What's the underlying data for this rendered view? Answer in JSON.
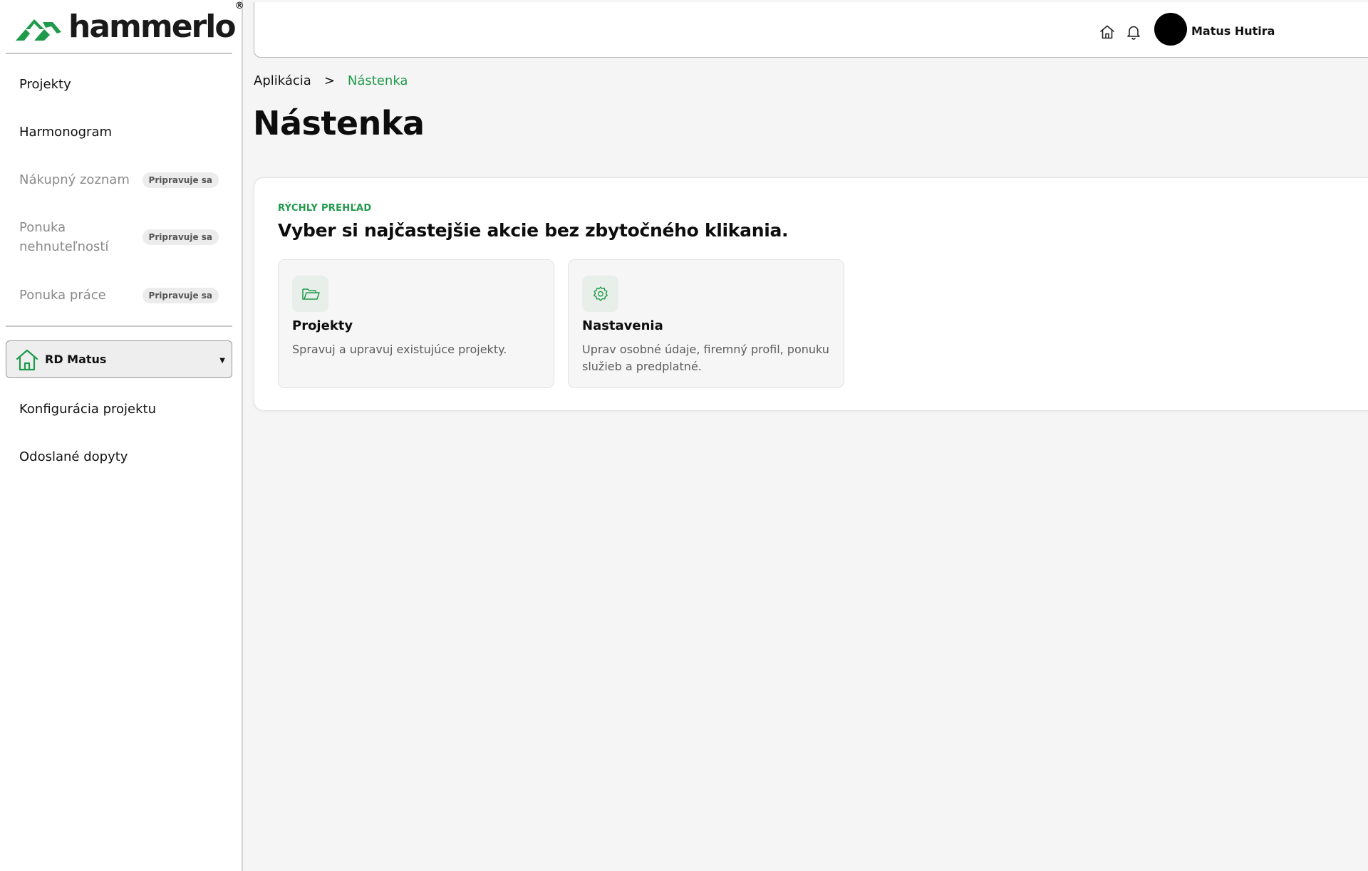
{
  "brand": {
    "name": "hammerlo",
    "registered": "®",
    "accent": "#1f9a4a"
  },
  "sidebar": {
    "items": [
      {
        "label": "Projekty"
      },
      {
        "label": "Harmonogram"
      },
      {
        "label": "Nákupný zoznam",
        "badge": "Pripravuje sa"
      },
      {
        "label": "Ponuka nehnuteľností",
        "badge": "Pripravuje sa"
      },
      {
        "label": "Ponuka práce",
        "badge": "Pripravuje sa"
      }
    ],
    "project_select": {
      "value": "RD Matus",
      "icon": "house-icon"
    },
    "project_items": [
      {
        "label": "Konfigurácia projektu"
      },
      {
        "label": "Odoslané dopyty"
      }
    ]
  },
  "topbar": {
    "icons": [
      "home-icon",
      "bell-icon"
    ],
    "user_name": "Matus Hutira"
  },
  "breadcrumb": {
    "root": "Aplikácia",
    "separator": ">",
    "current": "Nástenka"
  },
  "page_title": "Nástenka",
  "quick": {
    "eyebrow": "RÝCHLY PREHĽAD",
    "title": "Vyber si najčastejšie akcie bez zbytočného klikania.",
    "cards": [
      {
        "title": "Projekty",
        "desc": "Spravuj a upravuj existujúce projekty.",
        "icon": "folder-icon"
      },
      {
        "title": "Nastavenia",
        "desc": "Uprav osobné údaje, firemný profil, ponuku služieb a predplatné.",
        "icon": "gear-icon"
      }
    ]
  }
}
